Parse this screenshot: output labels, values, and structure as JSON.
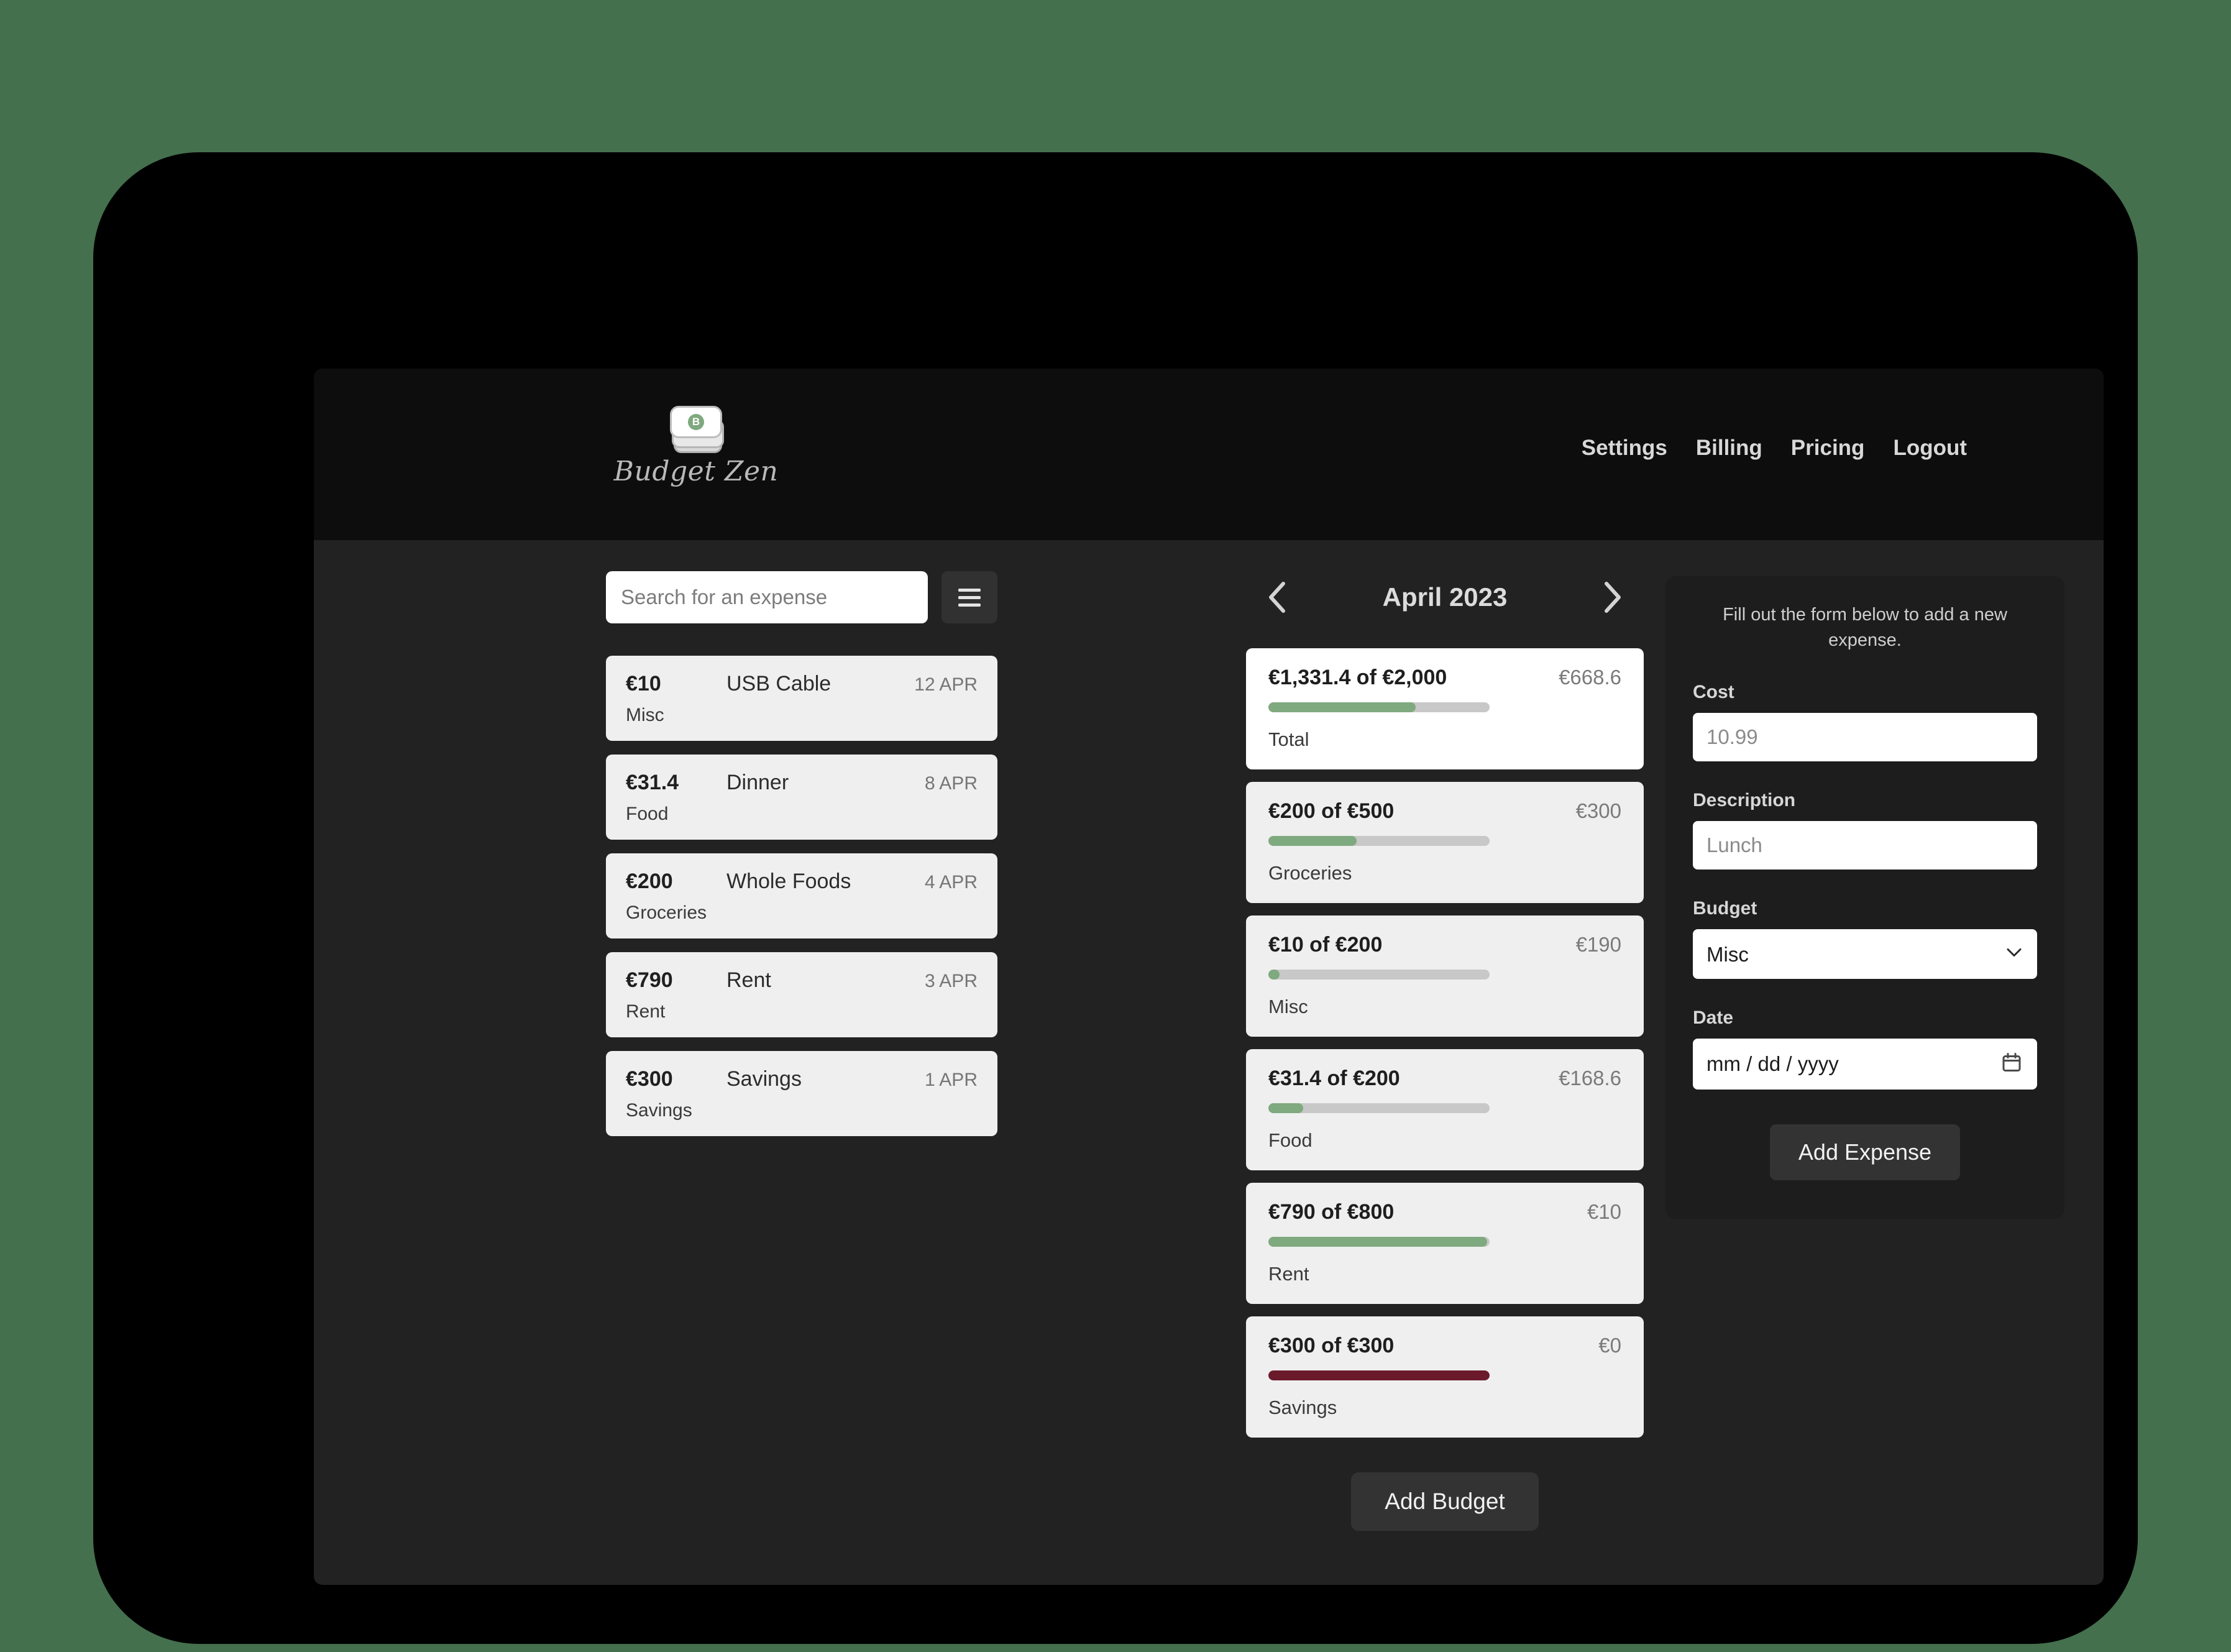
{
  "brand": {
    "name": "Budget Zen",
    "badge_letter": "B",
    "badge_color": "#7fa97f"
  },
  "nav": {
    "items": [
      {
        "label": "Settings"
      },
      {
        "label": "Billing"
      },
      {
        "label": "Pricing"
      },
      {
        "label": "Logout"
      }
    ]
  },
  "search": {
    "placeholder": "Search for an expense",
    "value": "",
    "filter_icon": "hamburger-icon"
  },
  "expenses": [
    {
      "amount": "€10",
      "description": "USB Cable",
      "date": "12 APR",
      "category": "Misc"
    },
    {
      "amount": "€31.4",
      "description": "Dinner",
      "date": "8 APR",
      "category": "Food"
    },
    {
      "amount": "€200",
      "description": "Whole Foods",
      "date": "4 APR",
      "category": "Groceries"
    },
    {
      "amount": "€790",
      "description": "Rent",
      "date": "3 APR",
      "category": "Rent"
    },
    {
      "amount": "€300",
      "description": "Savings",
      "date": "1 APR",
      "category": "Savings"
    }
  ],
  "month_nav": {
    "prev_icon": "chevron-left-icon",
    "next_icon": "chevron-right-icon",
    "label": "April 2023"
  },
  "budgets": [
    {
      "spent_label": "€1,331.4 of €2,000",
      "remaining_label": "€668.6",
      "name": "Total",
      "percent": 66.6,
      "bar_color": "#7fa97f",
      "is_total": true
    },
    {
      "spent_label": "€200 of €500",
      "remaining_label": "€300",
      "name": "Groceries",
      "percent": 40,
      "bar_color": "#7fa97f",
      "is_total": false
    },
    {
      "spent_label": "€10 of €200",
      "remaining_label": "€190",
      "name": "Misc",
      "percent": 5,
      "bar_color": "#7fa97f",
      "is_total": false
    },
    {
      "spent_label": "€31.4 of €200",
      "remaining_label": "€168.6",
      "name": "Food",
      "percent": 15.7,
      "bar_color": "#7fa97f",
      "is_total": false
    },
    {
      "spent_label": "€790 of €800",
      "remaining_label": "€10",
      "name": "Rent",
      "percent": 98.75,
      "bar_color": "#7fa97f",
      "is_total": false
    },
    {
      "spent_label": "€300 of €300",
      "remaining_label": "€0",
      "name": "Savings",
      "percent": 100,
      "bar_color": "#6b1a2c",
      "is_total": false
    }
  ],
  "add_budget": {
    "label": "Add Budget"
  },
  "form": {
    "intro": "Fill out the form below to add a new expense.",
    "cost": {
      "label": "Cost",
      "placeholder": "10.99",
      "value": ""
    },
    "description": {
      "label": "Description",
      "placeholder": "Lunch",
      "value": ""
    },
    "budget": {
      "label": "Budget",
      "selected": "Misc",
      "chevron_icon": "chevron-down-icon"
    },
    "date": {
      "label": "Date",
      "placeholder": "mm / dd / yyyy",
      "value": "",
      "calendar_icon": "calendar-icon"
    },
    "submit": {
      "label": "Add Expense"
    }
  }
}
